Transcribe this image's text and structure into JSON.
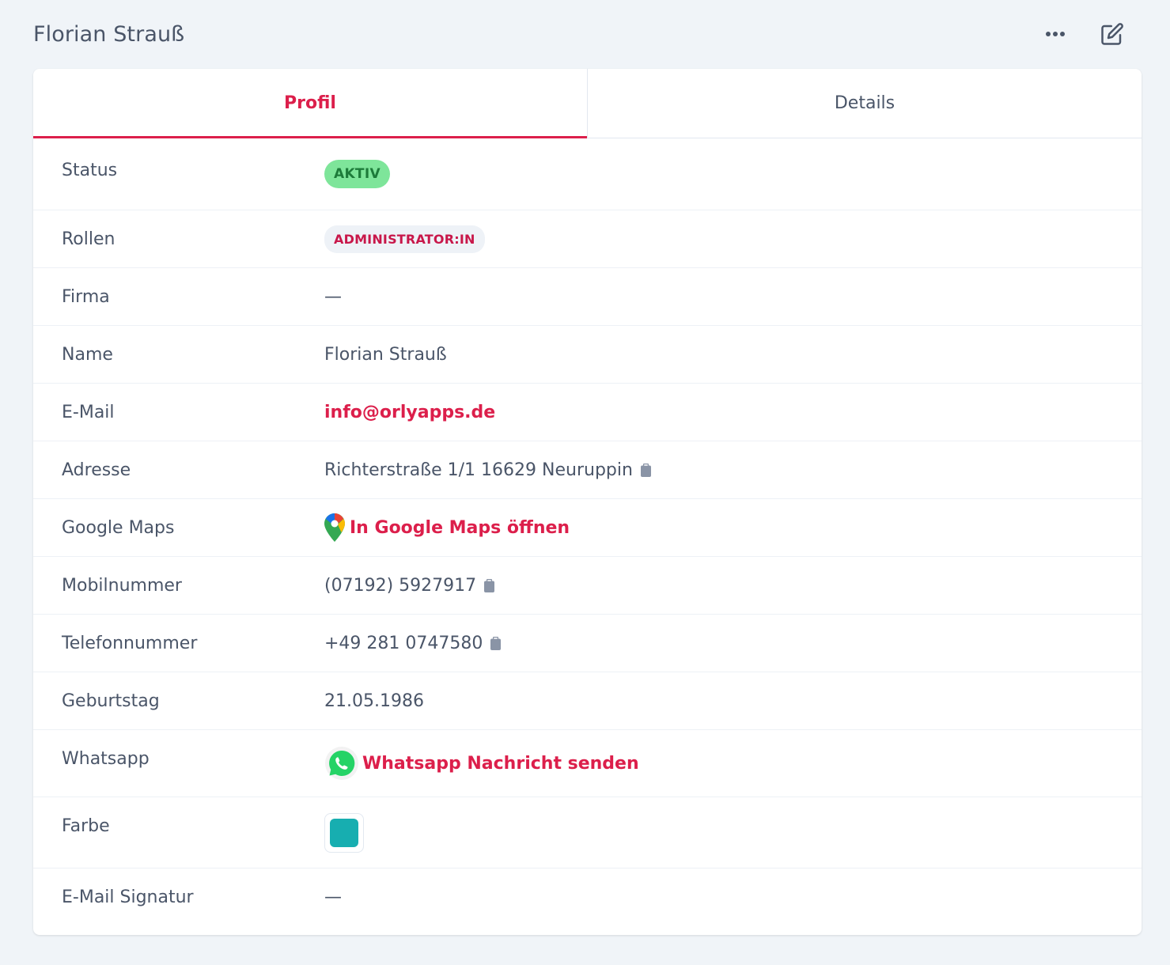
{
  "header": {
    "title": "Florian Strauß"
  },
  "tabs": [
    {
      "label": "Profil",
      "active": true
    },
    {
      "label": "Details",
      "active": false
    }
  ],
  "profile": {
    "status": {
      "label": "Status",
      "value": "AKTIV"
    },
    "roles": {
      "label": "Rollen",
      "value": "ADMINISTRATOR:IN"
    },
    "company": {
      "label": "Firma",
      "value": "—"
    },
    "name": {
      "label": "Name",
      "value": "Florian Strauß"
    },
    "email": {
      "label": "E-Mail",
      "value": "info@orlyapps.de"
    },
    "address": {
      "label": "Adresse",
      "value": "Richterstraße 1/1 16629 Neuruppin"
    },
    "maps": {
      "label": "Google Maps",
      "value": "In Google Maps öffnen"
    },
    "mobile": {
      "label": "Mobilnummer",
      "value": "(07192) 5927917"
    },
    "phone": {
      "label": "Telefonnummer",
      "value": "+49 281 0747580"
    },
    "birthday": {
      "label": "Geburtstag",
      "value": "21.05.1986"
    },
    "whatsapp": {
      "label": "Whatsapp",
      "value": "Whatsapp Nachricht senden"
    },
    "color": {
      "label": "Farbe",
      "value": "#17aeb0"
    },
    "signature": {
      "label": "E-Mail Signatur",
      "value": "—"
    }
  },
  "colors": {
    "accent": "#dc1f4b",
    "status_badge_bg": "#7ee59a",
    "status_badge_text": "#1d7b3a"
  },
  "icons": [
    "more-icon",
    "edit-icon",
    "clipboard-icon",
    "google-maps-icon",
    "whatsapp-icon"
  ]
}
